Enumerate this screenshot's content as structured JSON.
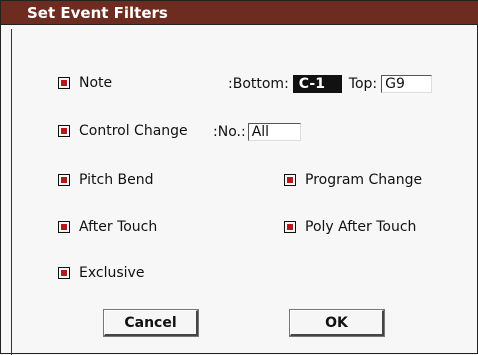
{
  "dialog": {
    "title": "Set Event Filters"
  },
  "filters": {
    "note": {
      "label": "Note",
      "checked": true
    },
    "bottom": {
      "label": ":Bottom:",
      "value": "C-1"
    },
    "top": {
      "label": "Top:",
      "value": "G9"
    },
    "control_change": {
      "label": "Control Change",
      "checked": true
    },
    "cc_no": {
      "label": ":No.:",
      "value": "All"
    },
    "pitch_bend": {
      "label": "Pitch Bend",
      "checked": true
    },
    "program_change": {
      "label": "Program Change",
      "checked": true
    },
    "after_touch": {
      "label": "After Touch",
      "checked": true
    },
    "poly_after_touch": {
      "label": "Poly After Touch",
      "checked": true
    },
    "exclusive": {
      "label": "Exclusive",
      "checked": true
    }
  },
  "buttons": {
    "cancel": "Cancel",
    "ok": "OK"
  },
  "colors": {
    "titlebar": "#6e2b20",
    "checkbox_mark": "#b31b1b"
  }
}
